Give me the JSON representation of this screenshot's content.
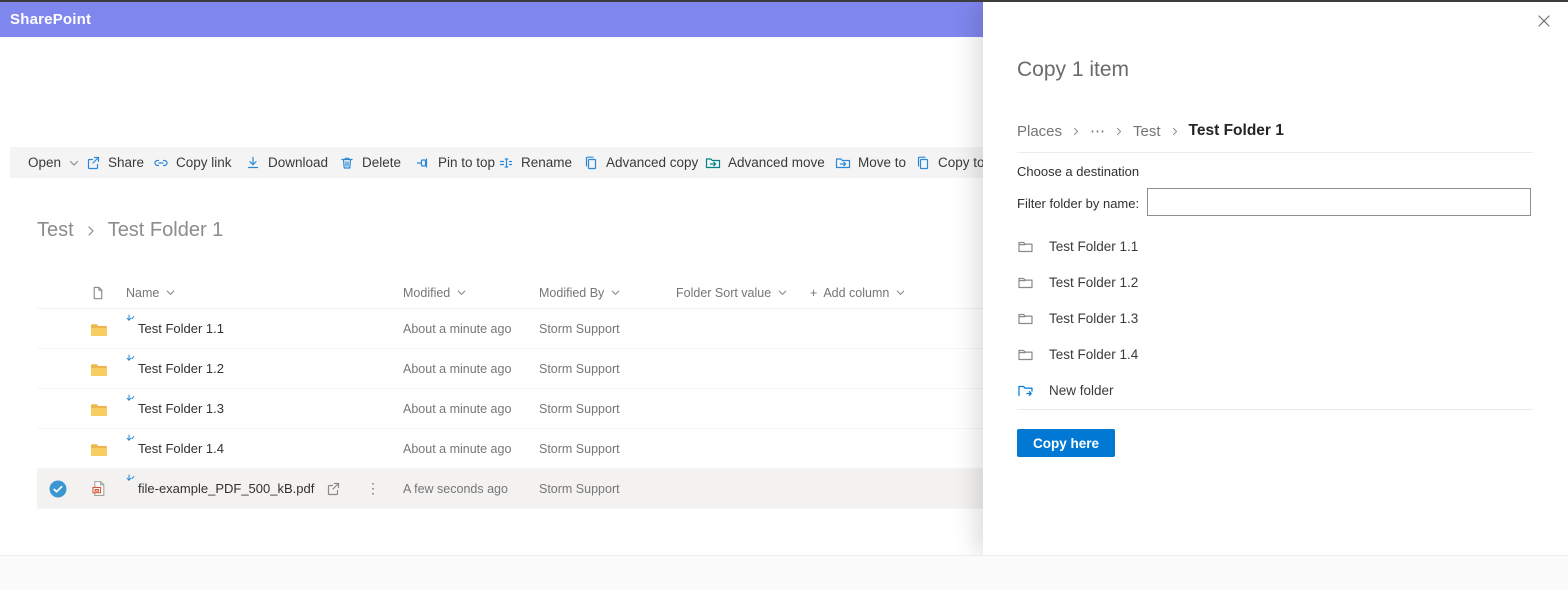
{
  "suite_bar": {
    "brand": "SharePoint"
  },
  "toolbar": {
    "items": [
      {
        "label": "Open"
      },
      {
        "label": "Share"
      },
      {
        "label": "Copy link"
      },
      {
        "label": "Download"
      },
      {
        "label": "Delete"
      },
      {
        "label": "Pin to top"
      },
      {
        "label": "Rename"
      },
      {
        "label": "Advanced copy"
      },
      {
        "label": "Advanced move"
      },
      {
        "label": "Move to"
      },
      {
        "label": "Copy to"
      }
    ]
  },
  "breadcrumb": {
    "items": [
      "Test",
      "Test Folder 1"
    ]
  },
  "table": {
    "columns": [
      "Name",
      "Modified",
      "Modified By",
      "Folder Sort value"
    ],
    "add_column": {
      "plus": "+",
      "label": "Add column"
    },
    "rows": [
      {
        "name": "Test Folder 1.1",
        "modified": "About a minute ago",
        "modified_by": "Storm Support"
      },
      {
        "name": "Test Folder 1.2",
        "modified": "About a minute ago",
        "modified_by": "Storm Support"
      },
      {
        "name": "Test Folder 1.3",
        "modified": "About a minute ago",
        "modified_by": "Storm Support"
      },
      {
        "name": "Test Folder 1.4",
        "modified": "About a minute ago",
        "modified_by": "Storm Support"
      },
      {
        "name": "file-example_PDF_500_kB.pdf",
        "modified": "A few seconds ago",
        "modified_by": "Storm Support"
      }
    ]
  },
  "panel": {
    "title": "Copy 1 item",
    "breadcrumb": {
      "places": "Places",
      "ellipsis": "⋯",
      "parent": "Test",
      "current": "Test Folder 1"
    },
    "choose_destination_label": "Choose a destination",
    "filter_label": "Filter folder by name:",
    "filter_value": "",
    "folders": [
      {
        "name": "Test Folder 1.1"
      },
      {
        "name": "Test Folder 1.2"
      },
      {
        "name": "Test Folder 1.3"
      },
      {
        "name": "Test Folder 1.4"
      }
    ],
    "new_folder_label": "New folder",
    "copy_button_label": "Copy here"
  },
  "icons": {
    "more_vertical": "⋮"
  },
  "colors": {
    "brand_purple": "#7f86ee",
    "accent_blue": "#0078d4",
    "icon_blue": "#2b88d8",
    "selection_blue": "#3b96d2",
    "folder_yellow": "#f8cd60",
    "pdf_red": "#d65532",
    "move_teal": "#038387"
  }
}
